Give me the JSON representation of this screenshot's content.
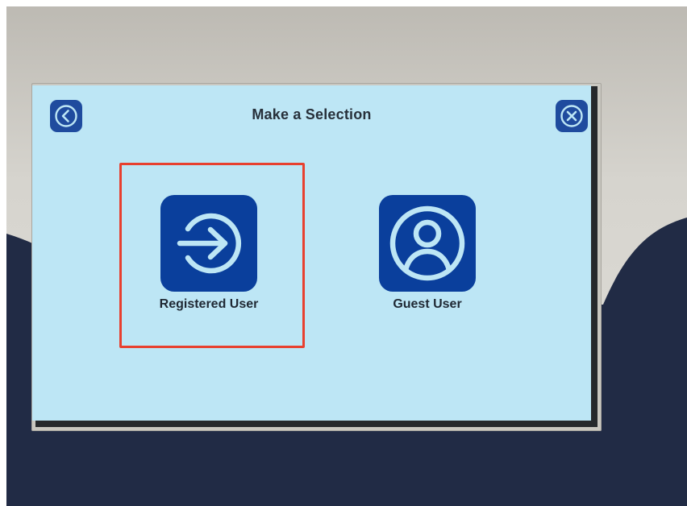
{
  "screen": {
    "title": "Make a Selection",
    "back_icon": "chevron-left-circle-icon",
    "close_icon": "close-circle-icon"
  },
  "options": [
    {
      "label": "Registered User",
      "icon": "sign-in-arrow-icon",
      "highlighted": true
    },
    {
      "label": "Guest User",
      "icon": "user-circle-icon",
      "highlighted": false
    }
  ],
  "colors": {
    "screen_background": "#bde6f5",
    "tile": "#0a3f9c",
    "icon_stroke": "#bde6f5",
    "highlight": "#e8402f"
  }
}
